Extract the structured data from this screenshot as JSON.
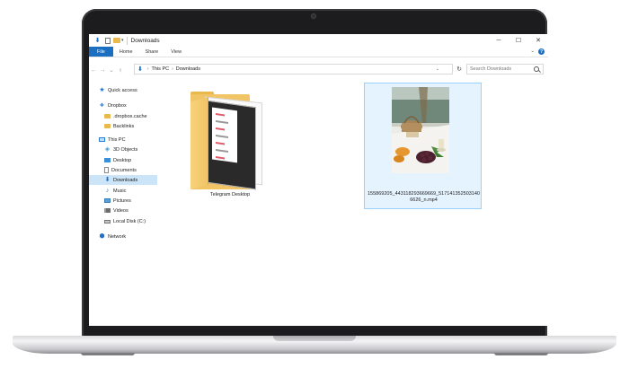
{
  "window": {
    "title": "Downloads",
    "controls": {
      "minimize": "─",
      "maximize": "☐",
      "close": "✕"
    }
  },
  "ribbon": {
    "tabs": [
      "File",
      "Home",
      "Share",
      "View"
    ],
    "expand_glyph": "⌄",
    "help_glyph": "?"
  },
  "address": {
    "back": "←",
    "forward": "→",
    "recent": "⌄",
    "up": "↑",
    "crumbs": [
      "This PC",
      "Downloads"
    ],
    "crumb_separator": "›",
    "dropdown": "⌄",
    "refresh": "↻"
  },
  "search": {
    "placeholder": "Search Downloads"
  },
  "navigation": {
    "items": [
      {
        "label": "Quick access",
        "icon": "star-icon"
      },
      {
        "label": "Dropbox",
        "icon": "dropbox-icon"
      },
      {
        "label": ".dropbox.cache",
        "icon": "folder-icon"
      },
      {
        "label": "Backlinks",
        "icon": "folder-icon"
      },
      {
        "label": "This PC",
        "icon": "computer-icon"
      },
      {
        "label": "3D Objects",
        "icon": "cube-icon"
      },
      {
        "label": "Desktop",
        "icon": "desktop-icon"
      },
      {
        "label": "Documents",
        "icon": "documents-icon"
      },
      {
        "label": "Downloads",
        "icon": "download-icon",
        "selected": true
      },
      {
        "label": "Music",
        "icon": "music-icon"
      },
      {
        "label": "Pictures",
        "icon": "pictures-icon"
      },
      {
        "label": "Videos",
        "icon": "videos-icon"
      },
      {
        "label": "Local Disk (C:)",
        "icon": "disk-icon"
      },
      {
        "label": "Network",
        "icon": "network-icon"
      }
    ]
  },
  "files": [
    {
      "name": "Telegram Desktop",
      "type": "folder"
    },
    {
      "name": "155869205_443118293669669_5171413525031406626_n.mp4",
      "type": "video",
      "selected": true
    }
  ],
  "colors": {
    "accent": "#1a6fc2",
    "selection": "#cce4f7",
    "tile_selection": "#e5f3ff",
    "folder": "#f1c466"
  }
}
